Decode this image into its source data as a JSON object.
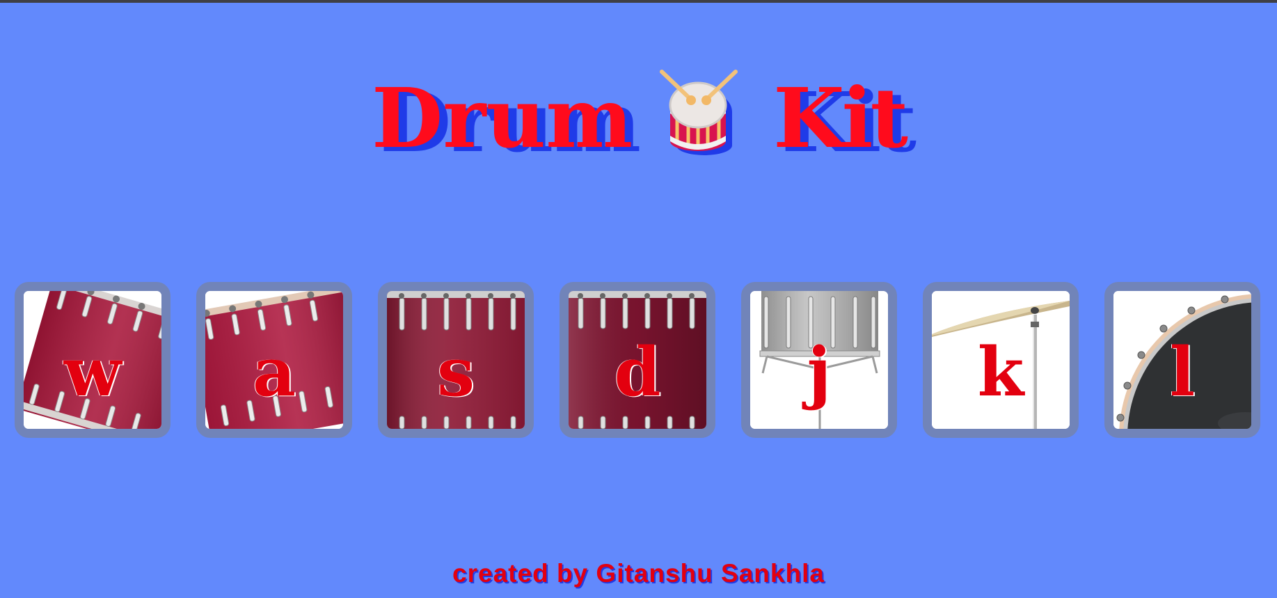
{
  "page": {
    "background_color": "#6289fc",
    "title_word_1": "Drum",
    "title_word_2": "Kit",
    "title_icon": "drum-emoji-icon",
    "title_color": "#ff0b1c",
    "title_shadow_color": "#1f3be8"
  },
  "pads": [
    {
      "key": "w",
      "instrument_icon": "tom-1-icon"
    },
    {
      "key": "a",
      "instrument_icon": "tom-2-icon"
    },
    {
      "key": "s",
      "instrument_icon": "tom-3-icon"
    },
    {
      "key": "d",
      "instrument_icon": "tom-4-icon"
    },
    {
      "key": "j",
      "instrument_icon": "snare-icon"
    },
    {
      "key": "k",
      "instrument_icon": "crash-cymbal-icon"
    },
    {
      "key": "l",
      "instrument_icon": "kick-drum-icon"
    }
  ],
  "pad_style": {
    "border_color": "#7184b9",
    "key_color": "#e3000f"
  },
  "footer": {
    "text": "created by Gitanshu Sankhla"
  }
}
